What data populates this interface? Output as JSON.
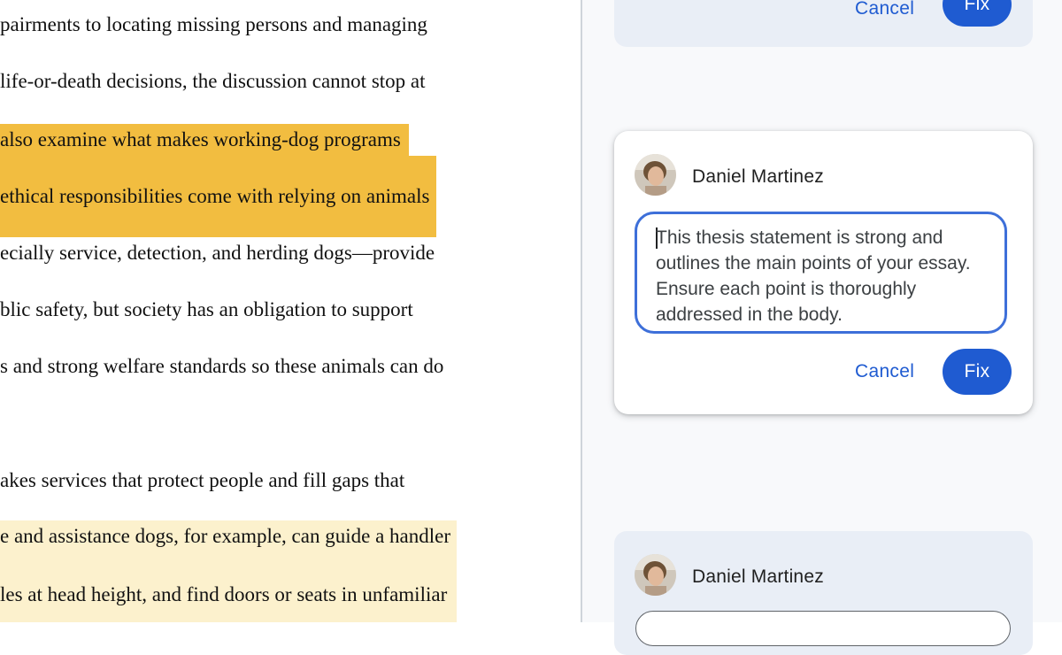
{
  "document": {
    "lines": [
      {
        "text": "pairments to locating missing persons and managing",
        "highlight": "none"
      },
      {
        "text": " life-or-death decisions, the discussion cannot stop at",
        "highlight": "none"
      },
      {
        "text": "also examine what makes working-dog programs",
        "highlight": "strong"
      },
      {
        "text": "ethical responsibilities come with relying on animals",
        "highlight": "strong"
      },
      {
        "text": "ecially service, detection, and herding dogs—provide",
        "highlight": "none"
      },
      {
        "text": "blic safety, but society has an obligation to support",
        "highlight": "none"
      },
      {
        "text": "s and strong welfare standards so these animals can do",
        "highlight": "none"
      },
      {
        "text": "akes services that protect people and fill gaps that",
        "highlight": "none"
      },
      {
        "text": "e and assistance dogs, for example, can guide a handler",
        "highlight": "soft"
      },
      {
        "text": "les at head height, and find doors or seats in unfamiliar",
        "highlight": "soft"
      }
    ]
  },
  "comments": {
    "top_card": {
      "cancel_label": "Cancel",
      "fix_label": "Fix"
    },
    "active_card": {
      "author": "Daniel Martinez",
      "reply_text": "This thesis statement is strong and outlines the main points of your essay. Ensure each point is thoroughly addressed in the body.",
      "cancel_label": "Cancel",
      "fix_label": "Fix"
    },
    "bottom_card": {
      "author": "Daniel Martinez"
    }
  },
  "colors": {
    "highlight_strong": "#f2bd40",
    "highlight_soft": "#fcf1cd",
    "accent": "#1f5bd1",
    "focus_border": "#3d6fd9",
    "muted_card": "#e9eef6"
  }
}
